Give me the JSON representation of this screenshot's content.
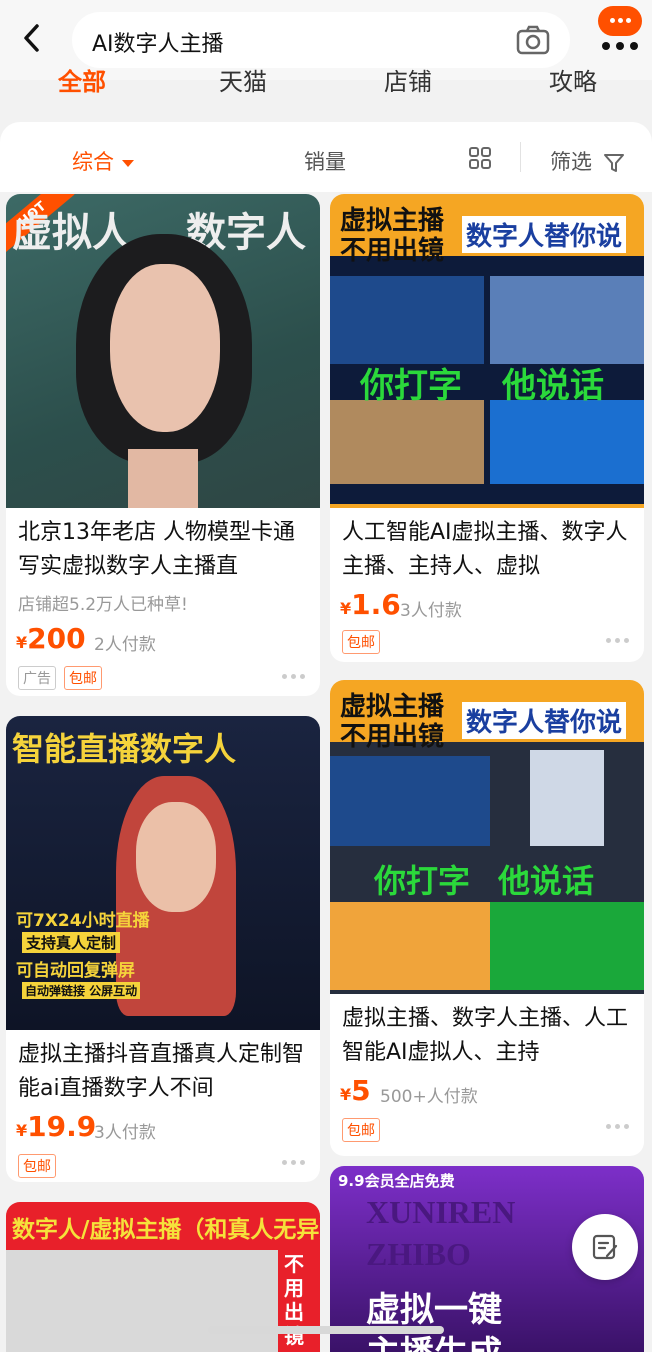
{
  "search": {
    "query": "AI数字人主播"
  },
  "tabs": [
    "全部",
    "天猫",
    "店铺",
    "攻略"
  ],
  "sort": {
    "comprehensive": "综合",
    "sales": "销量",
    "filter": "筛选"
  },
  "colors": {
    "accent": "#ff5000"
  },
  "products": [
    {
      "badge": "HOT",
      "image_text": [
        "虚拟人",
        "数字人"
      ],
      "title": "北京13年老店 人物模型卡通写实虚拟数字人主播直",
      "subtitle": "店铺超5.2万人已种草!",
      "currency": "¥",
      "price": "200",
      "paid": "2人付款",
      "tags": [
        "广告",
        "包邮"
      ]
    },
    {
      "image_text": [
        "虚拟主播",
        "不用出镜",
        "数字人替你说",
        "你打字",
        "他说话"
      ],
      "title": "人工智能AI虚拟主播、数字人主播、主持人、虚拟",
      "currency": "¥",
      "price": "1.6",
      "paid": "3人付款",
      "tags": [
        "包邮"
      ]
    },
    {
      "image_text": [
        "智能直播数字人",
        "可7X24小时直播",
        "支持真人定制",
        "可自动回复弹屏",
        "自动弹链接 公屏互动"
      ],
      "title": "虚拟主播抖音直播真人定制智能ai直播数字人不间",
      "currency": "¥",
      "price": "19.9",
      "paid": "3人付款",
      "tags": [
        "包邮"
      ]
    },
    {
      "image_text": [
        "虚拟主播",
        "不用出镜",
        "数字人替你说",
        "你打字",
        "他说话"
      ],
      "title": "虚拟主播、数字人主播、人工智能AI虚拟人、主持",
      "currency": "¥",
      "price": "5",
      "paid": "500+人付款",
      "tags": [
        "包邮"
      ]
    },
    {
      "image_text": [
        "数字人/虚拟主播（和真人无异）",
        "不用出镜"
      ]
    },
    {
      "image_text": [
        "9.9会员全店免费",
        "XUNIREN",
        "ZHIBO",
        "虚拟一键",
        "主播生成"
      ]
    }
  ]
}
